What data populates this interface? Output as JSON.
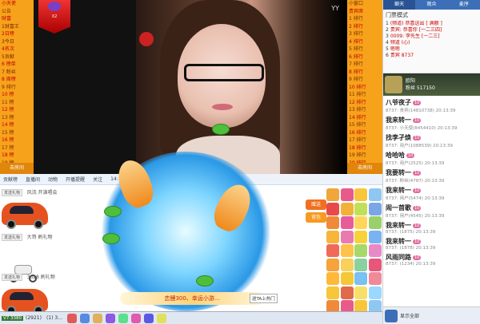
{
  "left_strip": {
    "rows": [
      "小天使",
      "公告",
      "财富",
      "1财富王",
      "2日榜",
      "3今日",
      "4名次",
      "5贡献",
      "6 榜单",
      "7 粉丝",
      "8 周榜",
      "9 排行",
      "10 榜",
      "11 榜",
      "12 榜",
      "13 榜",
      "14 榜",
      "15 榜",
      "16 榜",
      "17 榜",
      "18 榜",
      "19 榜",
      "20 榜",
      "21 榜"
    ],
    "footer": "去房间"
  },
  "badge": {
    "text": "X2"
  },
  "video": {
    "tag": "YY"
  },
  "right_strip": {
    "rows": [
      "小窗口",
      "贵宾席",
      "1 排行",
      "2 排行",
      "3 排行",
      "4 排行",
      "5 排行",
      "6 排行",
      "7 排行",
      "8 排行",
      "9 排行",
      "10 排行",
      "11 排行",
      "12 排行",
      "13 排行",
      "14 排行",
      "15 排行",
      "16 排行",
      "17 排行",
      "18 排行",
      "19 排行",
      "20 排行",
      "21 排行"
    ],
    "footer": "去房间"
  },
  "chat": {
    "tabs": [
      "聊天",
      "观众",
      "麦序"
    ],
    "top_title": "门票模式",
    "top_rows": [
      {
        "n": "1",
        "t": "(频道) 恭喜送出 [ 满额 ]"
      },
      {
        "n": "2",
        "t": "贵宾: 恭喜你 [一二三四]"
      },
      {
        "n": "3",
        "t": "0009: 李先生 [一二三]"
      },
      {
        "n": "4",
        "t": "频道 (心)"
      },
      {
        "n": "5",
        "t": "嗯嗯"
      },
      {
        "n": "6",
        "t": "贵宾 8737"
      }
    ],
    "host_name": "欧阳",
    "host_sub": "粉丝 517150",
    "messages": [
      {
        "name": "八爷夜子",
        "lv": "10",
        "meta": "8737: 贵宾(14810738) 20:13:39"
      },
      {
        "name": "我来转一",
        "lv": "10",
        "meta": "8737: 小天使(8454410) 20:13:39"
      },
      {
        "name": "找李孑焕",
        "lv": "10",
        "meta": "8737: 用户(1088539) 20:13:39"
      },
      {
        "name": "哈哈哈",
        "lv": "10",
        "meta": "8737: 用户(2525) 20:13:39"
      },
      {
        "name": "我要转一",
        "lv": "10",
        "meta": "8737: 粉丝(4787) 20:13:39"
      },
      {
        "name": "我来转一",
        "lv": "10",
        "meta": "8737: 用户(5474) 20:13:39"
      },
      {
        "name": "闹一首歌",
        "lv": "10",
        "meta": "8737: 用户(4545) 20:13:39"
      },
      {
        "name": "我来转一",
        "lv": "10",
        "meta": "8737: (1875) 20:13:39"
      },
      {
        "name": "我来转一",
        "lv": "10",
        "meta": "8737: (1878) 20:13:39"
      },
      {
        "name": "风雨同路",
        "lv": "10",
        "meta": "8737: (1234) 20:13:39"
      }
    ],
    "footer_text": "显示全部"
  },
  "lower_bar": [
    "贡献榜",
    "直播间",
    "动物",
    "开播提醒",
    "关注",
    "14:10"
  ],
  "gift_feed": [
    {
      "btn": "发送礼物",
      "text": "风流 开演唱会"
    },
    {
      "btn": "发送礼物",
      "text": "大哥 刷礼物"
    },
    {
      "btn": "发送礼物",
      "text": "3628 刷礼物"
    }
  ],
  "banner": "恋鲤300、幸运小游...",
  "hint": "送TA上热门",
  "gift_side": [
    {
      "label": "赠送",
      "color": "#f07020"
    },
    {
      "label": "背包",
      "color": "#f79a20"
    }
  ],
  "gift_colors": [
    "#f0a63a",
    "#e85a8a",
    "#f7c63d",
    "#8ec7f2",
    "#e84a4a",
    "#f2b23a",
    "#c1e05a",
    "#7aa6e8",
    "#f08a3a",
    "#e95c9a",
    "#ffd65a",
    "#9ad06a",
    "#f7b53a",
    "#e97ab0",
    "#f7d23a",
    "#7ab3f2",
    "#f06a5a",
    "#ffc24a",
    "#a8d86a",
    "#e88ac8",
    "#f7a23a",
    "#f9d05a",
    "#8ad0a0",
    "#e8567a",
    "#ffb83a",
    "#f5c83a",
    "#7ac0f0",
    "#f08a9a",
    "#f7c63a",
    "#e06a4a",
    "#f7e06a",
    "#9ad8ff",
    "#f08a3a",
    "#e85a8a",
    "#f7c63d",
    "#8ec7f2"
  ],
  "toolbar": {
    "level": "V7 3380",
    "items": [
      "(2921)",
      "(1) 3..."
    ],
    "icon_colors": [
      "#e05a5a",
      "#5a8ae0",
      "#e0b05a",
      "#8a5ae0",
      "#5ae08a",
      "#e05ab0",
      "#5a5ae0",
      "#e0e05a"
    ]
  }
}
